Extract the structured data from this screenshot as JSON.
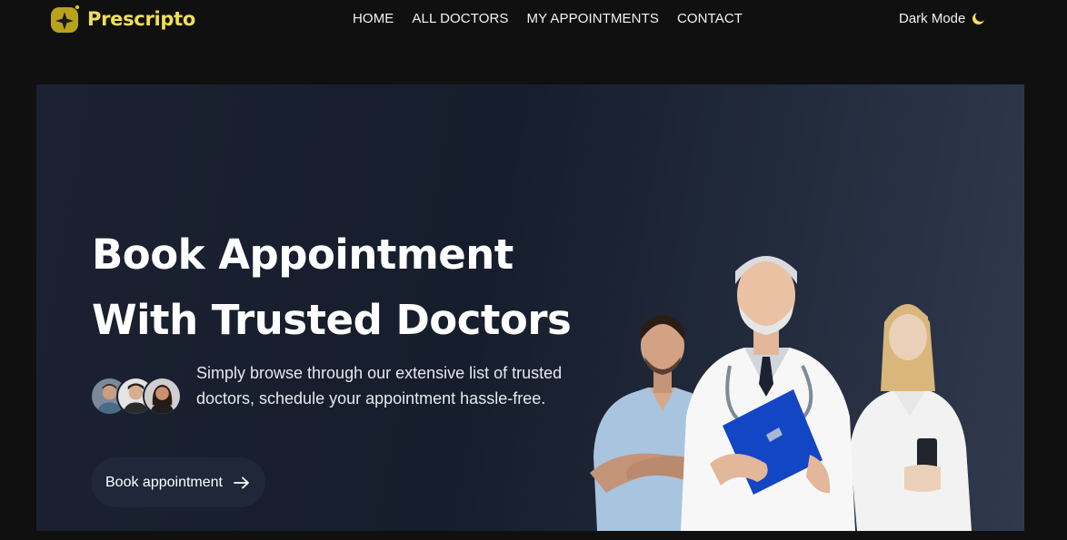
{
  "navbar": {
    "brand": "Prescripto",
    "links": [
      "HOME",
      "ALL DOCTORS",
      "MY APPOINTMENTS",
      "CONTACT"
    ],
    "theme_toggle_label": "Dark Mode",
    "theme_icon": "moon-icon",
    "brand_color": "#f2de57"
  },
  "hero": {
    "title_line1": "Book Appointment",
    "title_line2": "With Trusted Doctors",
    "description": "Simply browse through our extensive list of trusted doctors, schedule your appointment hassle-free.",
    "button_label": "Book appointment",
    "button_icon": "arrow-right-icon",
    "avatar_count": 3,
    "image": "doctors-group-illustration"
  },
  "colors": {
    "page_bg": "#101010",
    "hero_bg": "#1b2130",
    "accent": "#f2de57"
  }
}
